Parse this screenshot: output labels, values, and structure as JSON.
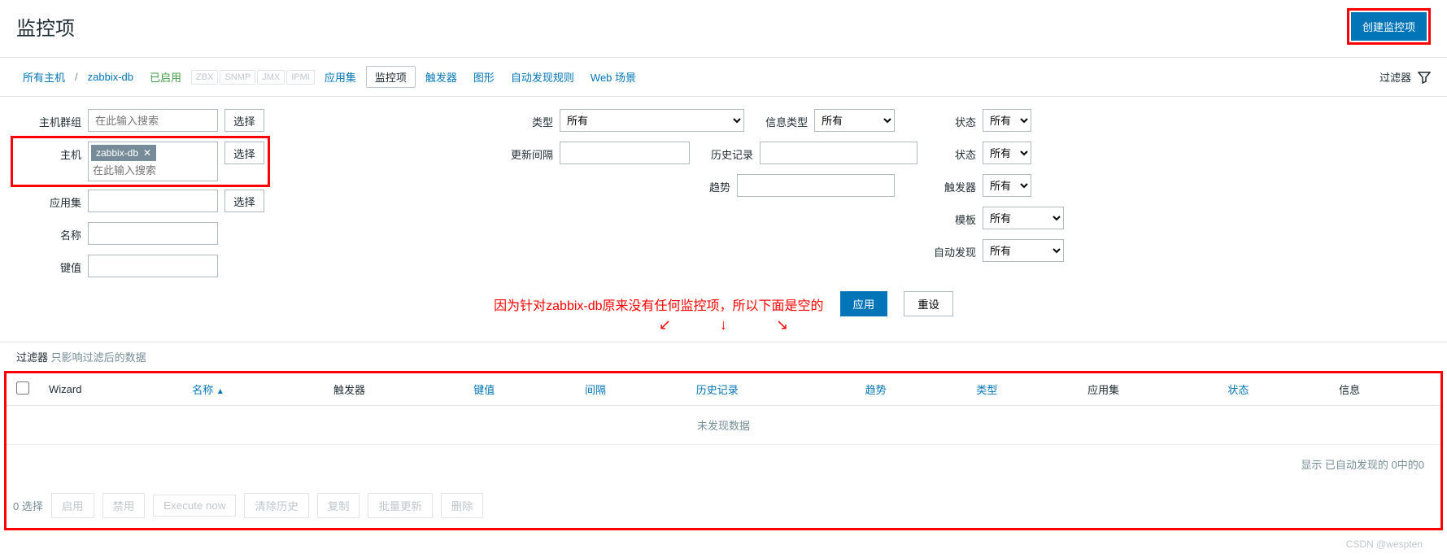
{
  "header": {
    "title": "监控项",
    "create_button": "创建监控项"
  },
  "nav": {
    "all_hosts": "所有主机",
    "host_name": "zabbix-db",
    "status": "已启用",
    "protocols": [
      "ZBX",
      "SNMP",
      "JMX",
      "IPMI"
    ],
    "tabs": {
      "applications": "应用集",
      "items": "监控项",
      "triggers": "触发器",
      "graphs": "图形",
      "discovery": "自动发现规则",
      "web": "Web 场景"
    },
    "filter_label": "过滤器"
  },
  "filter": {
    "left": {
      "host_group": {
        "label": "主机群组",
        "placeholder": "在此输入搜索",
        "btn": "选择"
      },
      "host": {
        "label": "主机",
        "tag": "zabbix-db",
        "placeholder": "在此输入搜索",
        "btn": "选择"
      },
      "application": {
        "label": "应用集",
        "btn": "选择"
      },
      "name": {
        "label": "名称"
      },
      "key": {
        "label": "键值"
      }
    },
    "mid": {
      "type": {
        "label": "类型",
        "value": "所有"
      },
      "info_type": {
        "label": "信息类型",
        "value": "所有"
      },
      "interval": {
        "label": "更新间隔"
      },
      "history": {
        "label": "历史记录"
      },
      "trends": {
        "label": "趋势"
      }
    },
    "right": {
      "state": {
        "label": "状态",
        "value": "所有"
      },
      "status": {
        "label": "状态",
        "value": "所有"
      },
      "triggers": {
        "label": "触发器",
        "value": "所有"
      },
      "template": {
        "label": "模板",
        "value": "所有"
      },
      "discovery": {
        "label": "自动发现",
        "value": "所有"
      }
    },
    "annotation": "因为针对zabbix-db原来没有任何监控项，所以下面是空的",
    "apply": "应用",
    "reset": "重设"
  },
  "filter_note": {
    "label": "过滤器",
    "sub": "只影响过滤后的数据"
  },
  "table": {
    "cols": {
      "wizard": "Wizard",
      "name": "名称",
      "triggers": "触发器",
      "key": "键值",
      "interval": "间隔",
      "history": "历史记录",
      "trends": "趋势",
      "type": "类型",
      "applications": "应用集",
      "status": "状态",
      "info": "信息"
    },
    "no_data": "未发现数据",
    "footer": "显示 已自动发现的 0中的0"
  },
  "actions": {
    "selected": "0 选择",
    "enable": "启用",
    "disable": "禁用",
    "execute": "Execute now",
    "clear_history": "清除历史",
    "copy": "复制",
    "mass_update": "批量更新",
    "delete": "删除"
  },
  "watermark": "CSDN @wespten"
}
